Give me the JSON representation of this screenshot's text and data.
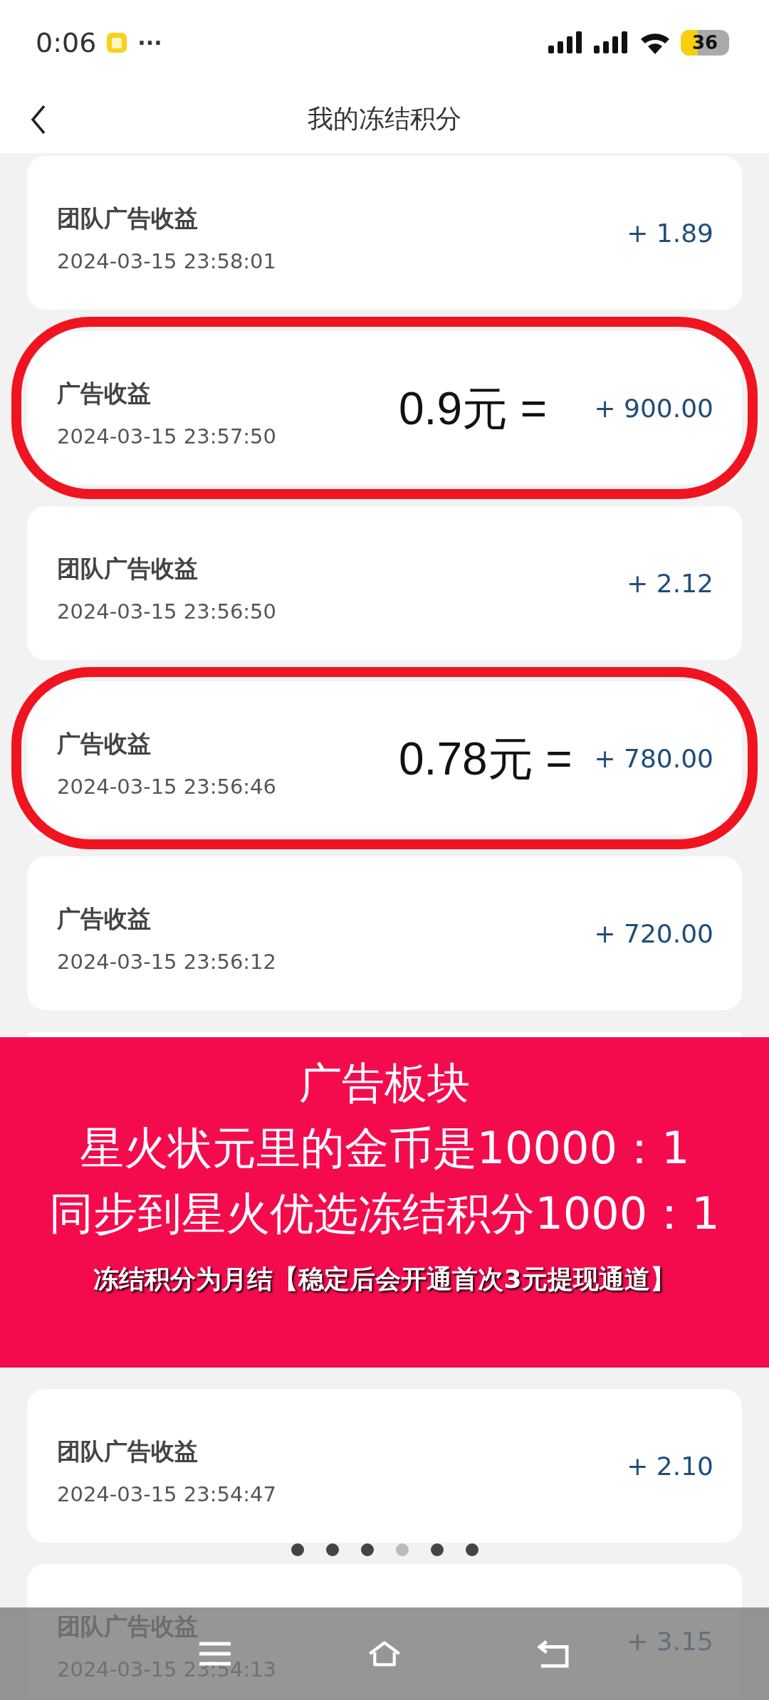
{
  "status_bar": {
    "time": "0:06",
    "more": "···",
    "battery": "36"
  },
  "header": {
    "title": "我的冻结积分"
  },
  "records_top": [
    {
      "title": "团队广告收益",
      "time": "2024-03-15 23:58:01",
      "amount": "+ 1.89",
      "circled": false
    },
    {
      "title": "广告收益",
      "time": "2024-03-15 23:57:50",
      "amount": "+ 900.00",
      "circled": true,
      "annotation": "0.9元 ="
    },
    {
      "title": "团队广告收益",
      "time": "2024-03-15 23:56:50",
      "amount": "+ 2.12",
      "circled": false
    },
    {
      "title": "广告收益",
      "time": "2024-03-15 23:56:46",
      "amount": "+ 780.00",
      "circled": true,
      "annotation": "0.78元 ="
    },
    {
      "title": "广告收益",
      "time": "2024-03-15 23:56:12",
      "amount": "+ 720.00",
      "circled": false
    }
  ],
  "banner": {
    "lines": [
      "广告板块",
      "星火状元里的金币是10000：1",
      "同步到星火优选冻结积分1000：1"
    ],
    "note": "冻结积分为月结【稳定后会开通首次3元提现通道】"
  },
  "records_bottom": [
    {
      "title": "团队广告收益",
      "time": "2024-03-15 23:54:47",
      "amount": "+ 2.10",
      "circled": false
    },
    {
      "title": "团队广告收益",
      "time": "2024-03-15 23:54:13",
      "amount": "+ 3.15",
      "circled": false
    }
  ],
  "page_dots": [
    {
      "selected": false
    },
    {
      "selected": false
    },
    {
      "selected": false
    },
    {
      "selected": true
    },
    {
      "selected": false
    },
    {
      "selected": false
    }
  ]
}
